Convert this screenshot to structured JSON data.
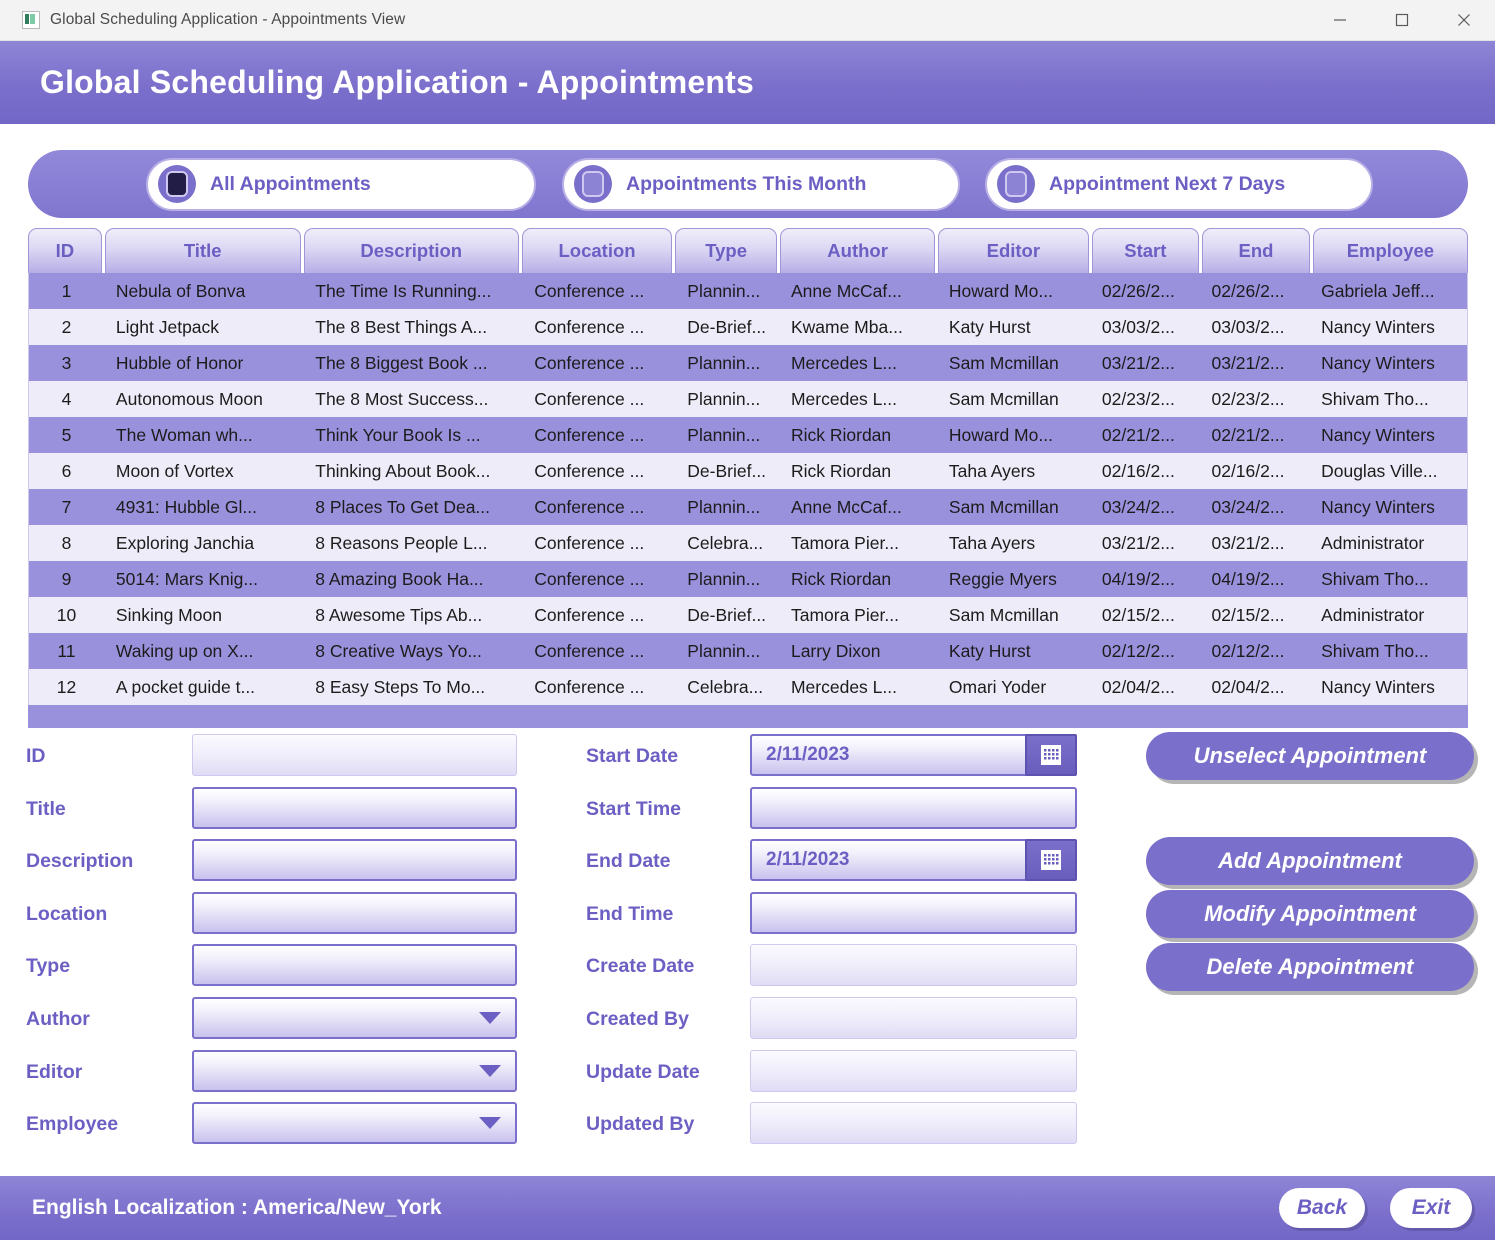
{
  "window": {
    "title": "Global Scheduling Application - Appointments View",
    "icon": "app-icon",
    "controls": {
      "minimize": "minimize-icon",
      "maximize": "maximize-icon",
      "close": "close-icon"
    }
  },
  "banner": {
    "title": "Global Scheduling Application - Appointments"
  },
  "filters": {
    "options": [
      {
        "label": "All Appointments",
        "selected": true
      },
      {
        "label": "Appointments This Month",
        "selected": false
      },
      {
        "label": "Appointment Next 7 Days",
        "selected": false
      }
    ]
  },
  "table": {
    "columns": [
      "ID",
      "Title",
      "Description",
      "Location",
      "Type",
      "Author",
      "Editor",
      "Start",
      "End",
      "Employee"
    ],
    "rows": [
      [
        "1",
        "Nebula of Bonva",
        "The Time Is Running...",
        "Conference ...",
        "Plannin...",
        "Anne McCaf...",
        "Howard Mo...",
        "02/26/2...",
        "02/26/2...",
        "Gabriela Jeff..."
      ],
      [
        "2",
        "Light Jetpack",
        "The 8 Best Things A...",
        "Conference ...",
        "De-Brief...",
        "Kwame Mba...",
        "Katy Hurst",
        "03/03/2...",
        "03/03/2...",
        "Nancy Winters"
      ],
      [
        "3",
        "Hubble of Honor",
        "The 8 Biggest Book ...",
        "Conference ...",
        "Plannin...",
        "Mercedes L...",
        "Sam Mcmillan",
        "03/21/2...",
        "03/21/2...",
        "Nancy Winters"
      ],
      [
        "4",
        "Autonomous Moon",
        "The 8 Most Success...",
        "Conference ...",
        "Plannin...",
        "Mercedes L...",
        "Sam Mcmillan",
        "02/23/2...",
        "02/23/2...",
        "Shivam Tho..."
      ],
      [
        "5",
        "The Woman wh...",
        "Think Your Book Is ...",
        "Conference ...",
        "Plannin...",
        "Rick Riordan",
        "Howard Mo...",
        "02/21/2...",
        "02/21/2...",
        "Nancy Winters"
      ],
      [
        "6",
        "Moon of Vortex",
        "Thinking About Book...",
        "Conference ...",
        "De-Brief...",
        "Rick Riordan",
        "Taha Ayers",
        "02/16/2...",
        "02/16/2...",
        "Douglas Ville..."
      ],
      [
        "7",
        "4931: Hubble Gl...",
        "8 Places To Get Dea...",
        "Conference ...",
        "Plannin...",
        "Anne McCaf...",
        "Sam Mcmillan",
        "03/24/2...",
        "03/24/2...",
        "Nancy Winters"
      ],
      [
        "8",
        "Exploring Janchia",
        "8 Reasons People L...",
        "Conference ...",
        "Celebra...",
        "Tamora Pier...",
        "Taha Ayers",
        "03/21/2...",
        "03/21/2...",
        "Administrator"
      ],
      [
        "9",
        "5014: Mars Knig...",
        "8 Amazing Book Ha...",
        "Conference ...",
        "Plannin...",
        "Rick Riordan",
        "Reggie Myers",
        "04/19/2...",
        "04/19/2...",
        "Shivam Tho..."
      ],
      [
        "10",
        "Sinking Moon",
        "8 Awesome Tips Ab...",
        "Conference ...",
        "De-Brief...",
        "Tamora Pier...",
        "Sam Mcmillan",
        "02/15/2...",
        "02/15/2...",
        "Administrator"
      ],
      [
        "11",
        "Waking up on X...",
        "8 Creative Ways Yo...",
        "Conference ...",
        "Plannin...",
        "Larry Dixon",
        "Katy Hurst",
        "02/12/2...",
        "02/12/2...",
        "Shivam Tho..."
      ],
      [
        "12",
        "A pocket guide t...",
        "8 Easy Steps To Mo...",
        "Conference ...",
        "Celebra...",
        "Mercedes L...",
        "Omari Yoder",
        "02/04/2...",
        "02/04/2...",
        "Nancy Winters"
      ]
    ]
  },
  "form": {
    "left": [
      {
        "label": "ID",
        "value": "",
        "kind": "readonly"
      },
      {
        "label": "Title",
        "value": "",
        "kind": "text"
      },
      {
        "label": "Description",
        "value": "",
        "kind": "text"
      },
      {
        "label": "Location",
        "value": "",
        "kind": "text"
      },
      {
        "label": "Type",
        "value": "",
        "kind": "text"
      },
      {
        "label": "Author",
        "value": "",
        "kind": "select"
      },
      {
        "label": "Editor",
        "value": "",
        "kind": "select"
      },
      {
        "label": "Employee",
        "value": "",
        "kind": "select"
      }
    ],
    "right": [
      {
        "label": "Start Date",
        "value": "2/11/2023",
        "kind": "date"
      },
      {
        "label": "Start Time",
        "value": "",
        "kind": "text"
      },
      {
        "label": "End Date",
        "value": "2/11/2023",
        "kind": "date"
      },
      {
        "label": "End Time",
        "value": "",
        "kind": "text"
      },
      {
        "label": "Create Date",
        "value": "",
        "kind": "readonly"
      },
      {
        "label": "Created By",
        "value": "",
        "kind": "readonly"
      },
      {
        "label": "Update Date",
        "value": "",
        "kind": "readonly"
      },
      {
        "label": "Updated By",
        "value": "",
        "kind": "readonly"
      }
    ],
    "calendar_icon": "calendar-icon"
  },
  "actions": {
    "unselect": "Unselect Appointment",
    "add": "Add Appointment",
    "modify": "Modify Appointment",
    "delete": "Delete Appointment"
  },
  "footer": {
    "localization": "English Localization : America/New_York",
    "back": "Back",
    "exit": "Exit"
  },
  "colors": {
    "accent": "#7a6fca",
    "banner": "#8076cf",
    "row_odd": "#9a91dd",
    "row_even": "#eeecf8",
    "label": "#6b5fc4",
    "radio_selected": "#221d47"
  }
}
